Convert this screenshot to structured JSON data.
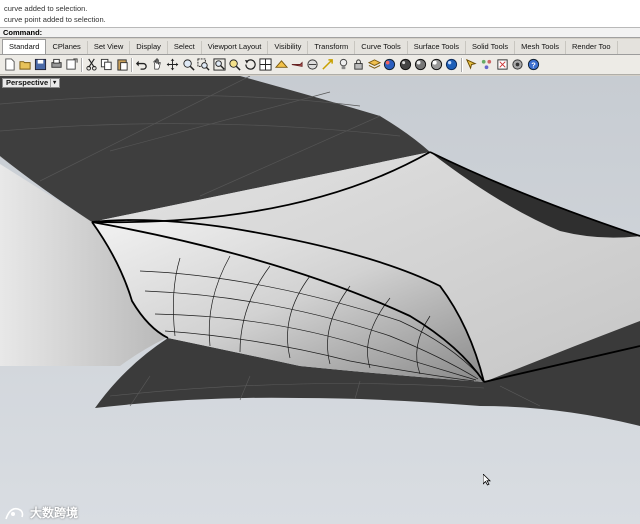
{
  "command_history": [
    "curve added to selection.",
    "curve point added to selection."
  ],
  "command_prompt": "Command:",
  "command_input_value": "",
  "tabs": [
    {
      "label": "Standard",
      "active": true
    },
    {
      "label": "CPlanes"
    },
    {
      "label": "Set View"
    },
    {
      "label": "Display"
    },
    {
      "label": "Select"
    },
    {
      "label": "Viewport Layout"
    },
    {
      "label": "Visibility"
    },
    {
      "label": "Transform"
    },
    {
      "label": "Curve Tools"
    },
    {
      "label": "Surface Tools"
    },
    {
      "label": "Solid Tools"
    },
    {
      "label": "Mesh Tools"
    },
    {
      "label": "Render Too"
    }
  ],
  "toolbar_icons": [
    "new-file-icon",
    "open-file-icon",
    "save-icon",
    "print-icon",
    "import-icon",
    "cut-icon",
    "copy-icon",
    "paste-icon",
    "undo-icon",
    "pan-icon",
    "move-view-icon",
    "zoom-icon",
    "zoom-window-icon",
    "zoom-extents-icon",
    "zoom-selected-icon",
    "rotate-view-icon",
    "four-view-icon",
    "cplane-icon",
    "camera-icon",
    "grid-snap-icon",
    "lock-icon",
    "light-icon",
    "layer-icon",
    "material-icon",
    "render-sphere-icon",
    "shaded-sphere-icon",
    "ghosted-sphere-icon",
    "xray-sphere-icon",
    "select-filter-icon",
    "options-icon",
    "group-icon",
    "render-icon",
    "help-icon"
  ],
  "viewport": {
    "label": "Perspective",
    "dropdown_glyph": "▾"
  },
  "watermark_text": "大数跨境",
  "colors": {
    "dark_surface": "#3e3e3e",
    "light_surface": "#d5d5d5",
    "viewport_background": "#c8ccd0",
    "outline": "#000000"
  }
}
